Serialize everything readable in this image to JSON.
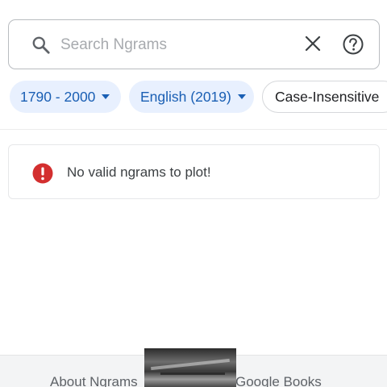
{
  "search": {
    "placeholder": "Search Ngrams",
    "value": ""
  },
  "icons": {
    "search": "search-icon",
    "clear": "close-icon",
    "help": "help-circle-icon",
    "error": "error-circle-icon",
    "dropdown": "caret-down-icon"
  },
  "filters": {
    "year_range": "1790 - 2000",
    "corpus": "English (2019)",
    "case": "Case-Insensitive"
  },
  "message": {
    "text": "No valid ngrams to plot!"
  },
  "footer": {
    "about_link": "About Ngrams",
    "books_link": "Google Books"
  },
  "colors": {
    "accent": "#1a5fb4",
    "chip_bg": "#e8f0fe",
    "error": "#d32f2f"
  }
}
